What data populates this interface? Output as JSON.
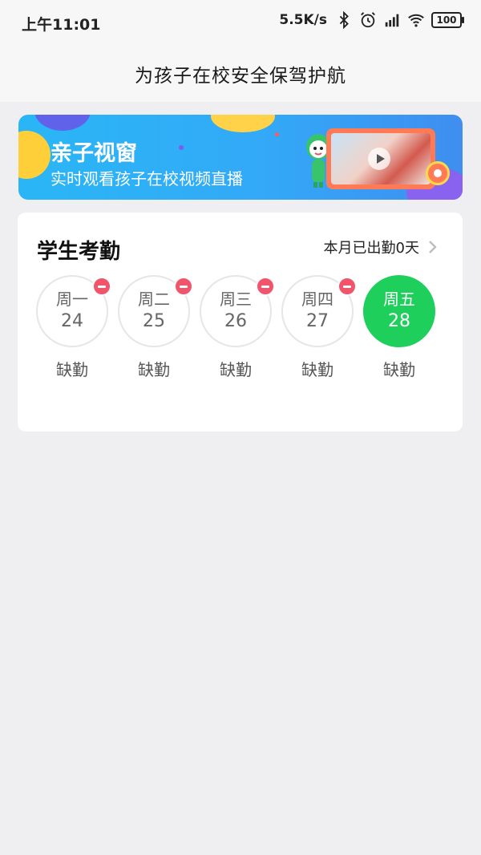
{
  "status_bar": {
    "time": "上午11:01",
    "network_speed": "5.5K/s",
    "battery": "100",
    "icons": [
      "bluetooth-icon",
      "alarm-icon",
      "hd-signal-icon",
      "wifi-icon",
      "battery-icon"
    ]
  },
  "header": {
    "title": "为孩子在校安全保驾护航"
  },
  "banner": {
    "title": "亲子视窗",
    "subtitle": "实时观看孩子在校视频直播"
  },
  "attendance": {
    "title": "学生考勤",
    "summary": "本月已出勤0天",
    "days": [
      {
        "weekday": "周一",
        "date": "24",
        "status": "缺勤",
        "absent": true
      },
      {
        "weekday": "周二",
        "date": "25",
        "status": "缺勤",
        "absent": true
      },
      {
        "weekday": "周三",
        "date": "26",
        "status": "缺勤",
        "absent": true
      },
      {
        "weekday": "周四",
        "date": "27",
        "status": "缺勤",
        "absent": true
      },
      {
        "weekday": "周五",
        "date": "28",
        "status": "缺勤",
        "absent": false,
        "today": true
      }
    ]
  },
  "colors": {
    "accent_green": "#1fcf5c",
    "absent_red": "#f2546b",
    "banner_blue": "#2ab6f6"
  }
}
